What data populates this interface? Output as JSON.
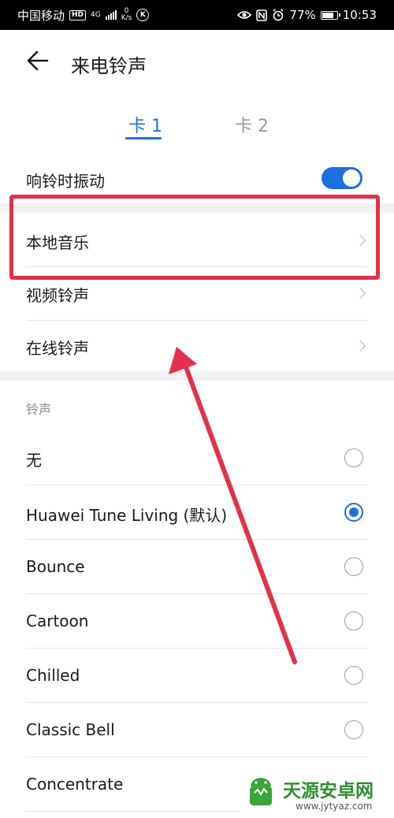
{
  "status_bar": {
    "carrier": "中国移动",
    "hd": "HD",
    "network": "4G",
    "speed_value": "0",
    "speed_unit": "K/s",
    "k_icon": "K",
    "battery": "77%",
    "time": "10:53"
  },
  "header": {
    "title": "来电铃声"
  },
  "tabs": [
    {
      "label": "卡 1",
      "active": true
    },
    {
      "label": "卡 2",
      "active": false
    }
  ],
  "vibrate": {
    "label": "响铃时振动",
    "enabled": true
  },
  "sources": [
    {
      "label": "本地音乐"
    },
    {
      "label": "视频铃声"
    },
    {
      "label": "在线铃声"
    }
  ],
  "ringtones": {
    "section_title": "铃声",
    "items": [
      {
        "label": "无",
        "selected": false
      },
      {
        "label": "Huawei Tune Living (默认)",
        "selected": true
      },
      {
        "label": "Bounce",
        "selected": false
      },
      {
        "label": "Cartoon",
        "selected": false
      },
      {
        "label": "Chilled",
        "selected": false
      },
      {
        "label": "Classic Bell",
        "selected": false
      },
      {
        "label": "Concentrate",
        "selected": false
      }
    ]
  },
  "watermark": {
    "name": "天源安卓网",
    "url": "www.jytyaz.com"
  },
  "colors": {
    "accent": "#1e6fe0",
    "annotation": "#e2314a"
  }
}
